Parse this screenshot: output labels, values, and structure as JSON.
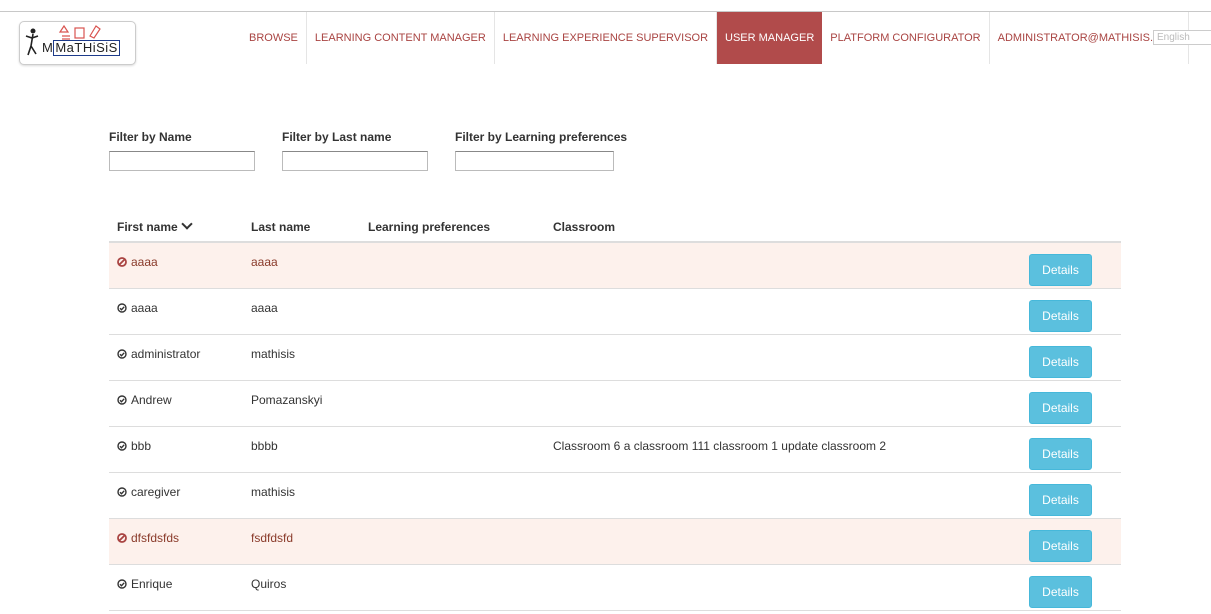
{
  "logo": {
    "text": "MaTHiSiS"
  },
  "nav": {
    "items": [
      {
        "label": "BROWSE",
        "active": false
      },
      {
        "label": "LEARNING CONTENT MANAGER",
        "active": false
      },
      {
        "label": "LEARNING EXPERIENCE SUPERVISOR",
        "active": false
      },
      {
        "label": "USER MANAGER",
        "active": true
      },
      {
        "label": "PLATFORM CONFIGURATOR",
        "active": false
      },
      {
        "label": "ADMINISTRATOR@MATHISIS.EU",
        "active": false
      }
    ],
    "language": "English"
  },
  "filters": {
    "name_label": "Filter by Name",
    "lastname_label": "Filter by Last name",
    "prefs_label": "Filter by Learning preferences",
    "name_value": "",
    "lastname_value": "",
    "prefs_value": ""
  },
  "table": {
    "headers": {
      "first_name": "First name",
      "last_name": "Last name",
      "learning_preferences": "Learning preferences",
      "classroom": "Classroom"
    },
    "details_label": "Details",
    "rows": [
      {
        "status": "disabled",
        "first_name": "aaaa",
        "last_name": "aaaa",
        "classroom": ""
      },
      {
        "status": "active",
        "first_name": "aaaa",
        "last_name": "aaaa",
        "classroom": ""
      },
      {
        "status": "active",
        "first_name": "administrator",
        "last_name": "mathisis",
        "classroom": ""
      },
      {
        "status": "active",
        "first_name": "Andrew",
        "last_name": "Pomazanskyi",
        "classroom": ""
      },
      {
        "status": "active",
        "first_name": "bbb",
        "last_name": "bbbb",
        "classroom": "Classroom 6 a classroom 111 classroom 1 update classroom 2"
      },
      {
        "status": "active",
        "first_name": "caregiver",
        "last_name": "mathisis",
        "classroom": ""
      },
      {
        "status": "disabled",
        "first_name": "dfsfdsfds",
        "last_name": "fsdfdsfd",
        "classroom": ""
      },
      {
        "status": "active",
        "first_name": "Enrique",
        "last_name": "Quiros",
        "classroom": ""
      }
    ]
  },
  "colors": {
    "accent": "#b14b4b",
    "nav_text": "#a94442",
    "details_button": "#5bc0de",
    "danger_row": "#fdf1ec"
  }
}
